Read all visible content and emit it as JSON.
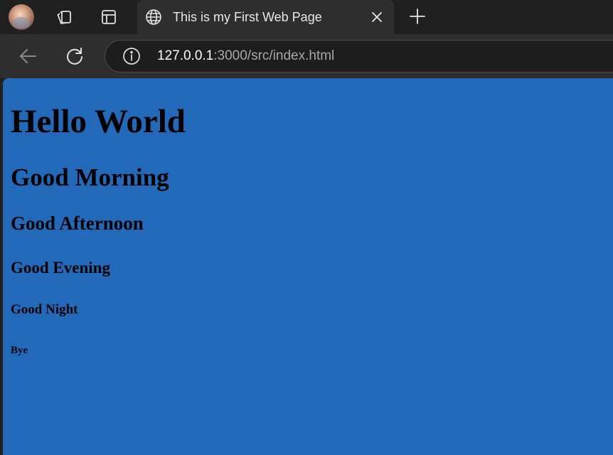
{
  "browser": {
    "tab": {
      "title": "This is my First Web Page"
    },
    "address_bar": {
      "url_host": "127.0.0.1",
      "url_rest": ":3000/src/index.html"
    },
    "icons": {
      "profile": "profile-avatar",
      "workspaces": "workspaces-icon",
      "tab_actions": "tab-actions-icon",
      "tab_favicon": "globe-icon",
      "close": "close-icon",
      "new_tab": "plus-icon",
      "back": "back-arrow-icon",
      "refresh": "refresh-icon",
      "site_info": "info-icon"
    }
  },
  "page": {
    "background_color": "#2269b9",
    "headings": {
      "h1": "Hello World",
      "h2": "Good Morning",
      "h3": "Good Afternoon",
      "h4": "Good Evening",
      "h5": "Good Night",
      "h6": "Bye"
    }
  }
}
